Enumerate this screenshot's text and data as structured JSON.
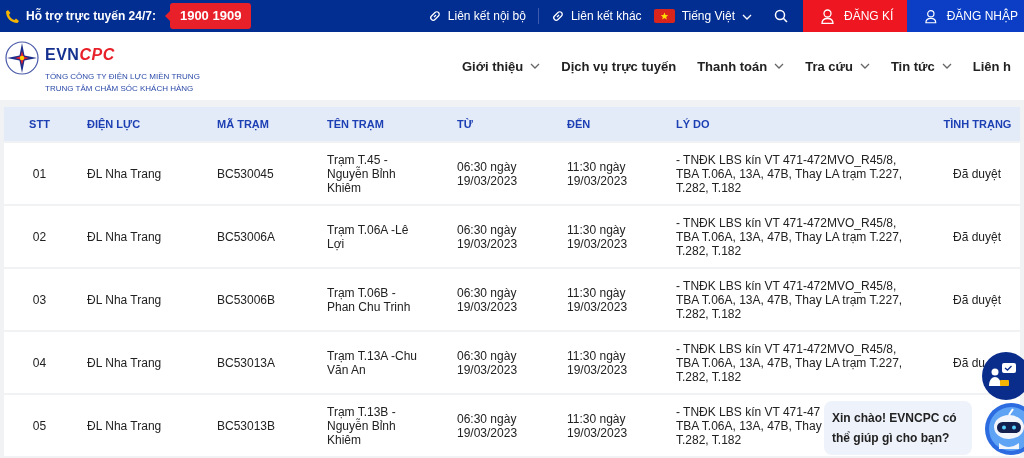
{
  "top_bar": {
    "hotline_label": "Hỗ trợ trực tuyến 24/7:",
    "hotline_number": "1900 1909",
    "links": [
      {
        "label": "Liên kết nội bộ"
      },
      {
        "label": "Liên kết khác"
      }
    ],
    "language": {
      "label": "Tiếng Việt",
      "has_dropdown": true
    },
    "register": "ĐĂNG KÍ",
    "login": "ĐĂNG NHẬP"
  },
  "header": {
    "brand": [
      "EVN",
      "CPC"
    ],
    "subtitle": [
      "TỔNG CÔNG TY ĐIỆN LỰC MIỀN TRUNG",
      "TRUNG TÂM CHĂM SÓC KHÁCH HÀNG"
    ],
    "nav": [
      {
        "label": "Giới thiệu",
        "has_dropdown": true
      },
      {
        "label": "Dịch vụ trực tuyến",
        "has_dropdown": false
      },
      {
        "label": "Thanh toán",
        "has_dropdown": true
      },
      {
        "label": "Tra cứu",
        "has_dropdown": true
      },
      {
        "label": "Tin tức",
        "has_dropdown": true
      },
      {
        "label": "Liên h",
        "has_dropdown": false
      }
    ]
  },
  "table": {
    "columns": [
      "STT",
      "ĐIỆN LỰC",
      "MÃ TRẠM",
      "TÊN TRẠM",
      "TỪ",
      "ĐẾN",
      "LÝ DO",
      "TÌNH TRẠNG"
    ],
    "rows": [
      {
        "stt": "01",
        "unit": "ĐL Nha Trang",
        "code": "BC530045",
        "name": "Trạm T.45 - Nguyễn Bỉnh Khiêm",
        "from": "06:30 ngày 19/03/2023",
        "to": "11:30 ngày 19/03/2023",
        "reason": [
          "- TNĐK LBS kín VT 471-472MVO_R45/8,",
          "TBA T.06A, 13A, 47B, Thay LA trạm T.227,",
          "T.282, T.182"
        ],
        "status": "Đã duyệt"
      },
      {
        "stt": "02",
        "unit": "ĐL Nha Trang",
        "code": "BC53006A",
        "name": "Trạm T.06A -Lê Lợi",
        "from": "06:30 ngày 19/03/2023",
        "to": "11:30 ngày 19/03/2023",
        "reason": [
          "- TNĐK LBS kín VT 471-472MVO_R45/8,",
          "TBA T.06A, 13A, 47B, Thay LA trạm T.227,",
          "T.282, T.182"
        ],
        "status": "Đã duyệt"
      },
      {
        "stt": "03",
        "unit": "ĐL Nha Trang",
        "code": "BC53006B",
        "name": "Trạm T.06B -Phan Chu Trinh",
        "from": "06:30 ngày 19/03/2023",
        "to": "11:30 ngày 19/03/2023",
        "reason": [
          "- TNĐK LBS kín VT 471-472MVO_R45/8,",
          "TBA T.06A, 13A, 47B, Thay LA trạm T.227,",
          "T.282, T.182"
        ],
        "status": "Đã duyệt"
      },
      {
        "stt": "04",
        "unit": "ĐL Nha Trang",
        "code": "BC53013A",
        "name": "Trạm T.13A -Chu Văn An",
        "from": "06:30 ngày 19/03/2023",
        "to": "11:30 ngày 19/03/2023",
        "reason": [
          "- TNĐK LBS kín VT 471-472MVO_R45/8,",
          "TBA T.06A, 13A, 47B, Thay LA trạm T.227,",
          "T.282, T.182"
        ],
        "status": "Đã du"
      },
      {
        "stt": "05",
        "unit": "ĐL Nha Trang",
        "code": "BC53013B",
        "name": "Trạm T.13B - Nguyễn Bỉnh Khiêm",
        "from": "06:30 ngày 19/03/2023",
        "to": "11:30 ngày 19/03/2023",
        "reason": [
          "- TNĐK LBS kín VT 471-47",
          "TBA T.06A, 13A, 47B, Thay",
          "T.282, T.182"
        ]
      }
    ]
  },
  "chat": {
    "greeting": "Xin chào! EVNCPC có thể giúp gì cho bạn?"
  }
}
